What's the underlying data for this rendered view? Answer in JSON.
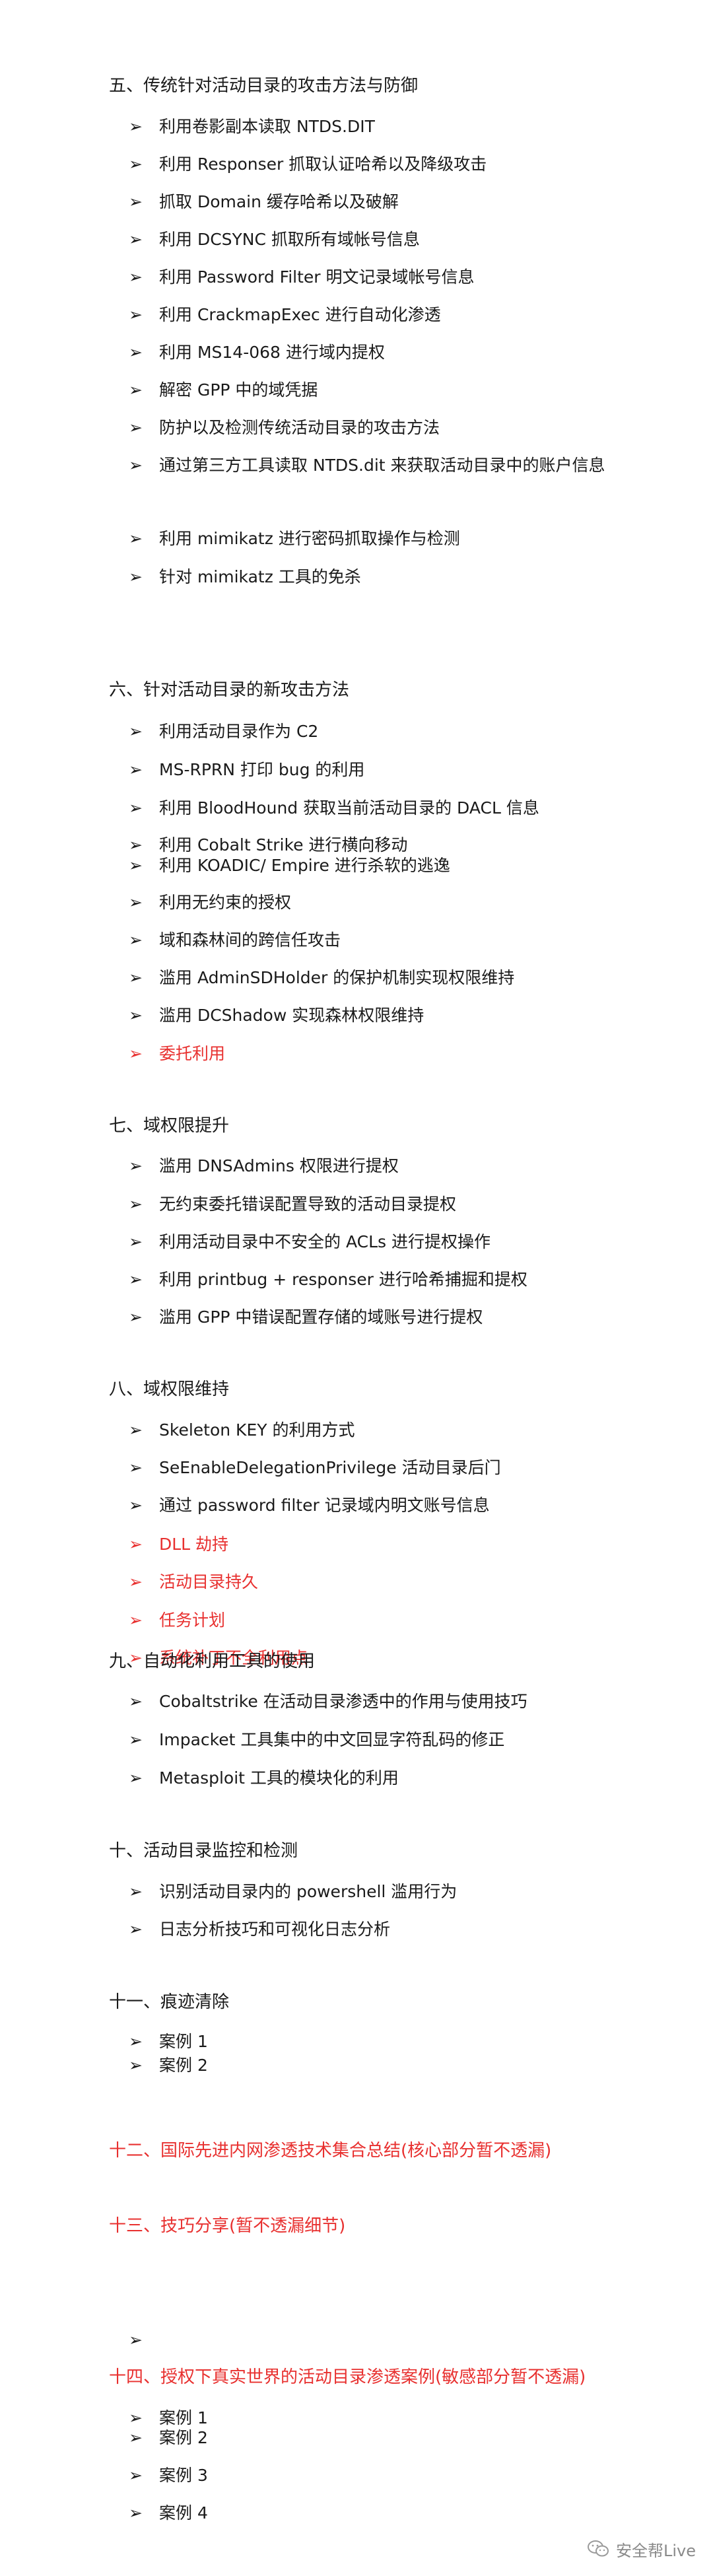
{
  "sections": [
    {
      "title": "五、传统针对活动目录的攻击方法与防御",
      "color": "#1a1a1a",
      "items": [
        {
          "text": "利用卷影副本读取 NTDS.DIT",
          "color": "#1a1a1a"
        },
        {
          "text": "利用 Responser 抓取认证哈希以及降级攻击",
          "color": "#1a1a1a"
        },
        {
          "text": "抓取 Domain 缓存哈希以及破解",
          "color": "#1a1a1a"
        },
        {
          "text": "利用 DCSYNC 抓取所有域帐号信息",
          "color": "#1a1a1a"
        },
        {
          "text": "利用 Password Filter 明文记录域帐号信息",
          "color": "#1a1a1a"
        },
        {
          "text": "利用 CrackmapExec 进行自动化渗透",
          "color": "#1a1a1a"
        },
        {
          "text": "利用 MS14-068 进行域内提权",
          "color": "#1a1a1a"
        },
        {
          "text": "解密 GPP 中的域凭据",
          "color": "#1a1a1a"
        },
        {
          "text": "防护以及检测传统活动目录的攻击方法",
          "color": "#1a1a1a"
        },
        {
          "text": "通过第三方工具读取 NTDS.dit 来获取活动目录中的账户信息",
          "color": "#1a1a1a"
        },
        {
          "text": "利用 mimikatz 进行密码抓取操作与检测",
          "color": "#1a1a1a"
        },
        {
          "text": "针对 mimikatz 工具的免杀",
          "color": "#1a1a1a"
        }
      ]
    },
    {
      "title": "六、针对活动目录的新攻击方法",
      "color": "#1a1a1a",
      "items": [
        {
          "text": "利用活动目录作为 C2",
          "color": "#1a1a1a"
        },
        {
          "text": "MS-RPRN 打印 bug 的利用",
          "color": "#1a1a1a"
        },
        {
          "text": "利用 BloodHound 获取当前活动目录的 DACL 信息",
          "color": "#1a1a1a"
        },
        {
          "text": "利用 Cobalt Strike 进行横向移动",
          "color": "#1a1a1a"
        },
        {
          "text": "利用 KOADIC/ Empire 进行杀软的逃逸",
          "color": "#1a1a1a"
        },
        {
          "text": "利用无约束的授权",
          "color": "#1a1a1a"
        },
        {
          "text": "域和森林间的跨信任攻击",
          "color": "#1a1a1a"
        },
        {
          "text": "滥用 AdminSDHolder 的保护机制实现权限维持",
          "color": "#1a1a1a"
        },
        {
          "text": "滥用 DCShadow 实现森林权限维持",
          "color": "#1a1a1a"
        },
        {
          "text": "委托利用",
          "color": "#e8302f"
        }
      ]
    },
    {
      "title": "七、域权限提升",
      "color": "#1a1a1a",
      "items": [
        {
          "text": "滥用 DNSAdmins 权限进行提权",
          "color": "#1a1a1a"
        },
        {
          "text": "无约束委托错误配置导致的活动目录提权",
          "color": "#1a1a1a"
        },
        {
          "text": "利用活动目录中不安全的 ACLs 进行提权操作",
          "color": "#1a1a1a"
        },
        {
          "text": "利用 printbug + responser 进行哈希捕掘和提权",
          "color": "#1a1a1a"
        },
        {
          "text": "滥用 GPP 中错误配置存储的域账号进行提权",
          "color": "#1a1a1a"
        }
      ]
    },
    {
      "title": "八、域权限维持",
      "color": "#1a1a1a",
      "items": [
        {
          "text": "Skeleton KEY 的利用方式",
          "color": "#1a1a1a"
        },
        {
          "text": "SeEnableDelegationPrivilege 活动目录后门",
          "color": "#1a1a1a"
        },
        {
          "text": "通过 password filter 记录域内明文账号信息",
          "color": "#1a1a1a"
        },
        {
          "text": "DLL 劫持",
          "color": "#e8302f"
        },
        {
          "text": "活动目录持久",
          "color": "#e8302f"
        },
        {
          "text": "任务计划",
          "color": "#e8302f"
        },
        {
          "text": "系统补丁不全利用点",
          "color": "#e8302f"
        }
      ]
    },
    {
      "title": "九、自动化利用工具的使用",
      "color": "#1a1a1a",
      "items": [
        {
          "text": "Cobaltstrike 在活动目录渗透中的作用与使用技巧",
          "color": "#1a1a1a"
        },
        {
          "text": "Impacket 工具集中的中文回显字符乱码的修正",
          "color": "#1a1a1a"
        },
        {
          "text": "Metasploit 工具的模块化的利用",
          "color": "#1a1a1a"
        }
      ]
    },
    {
      "title": "十、活动目录监控和检测",
      "color": "#1a1a1a",
      "items": [
        {
          "text": "识别活动目录内的 powershell 滥用行为",
          "color": "#1a1a1a"
        },
        {
          "text": "日志分析技巧和可视化日志分析",
          "color": "#1a1a1a"
        }
      ]
    },
    {
      "title": "十一、痕迹清除",
      "color": "#1a1a1a",
      "items": [
        {
          "text": "案例 1",
          "color": "#1a1a1a"
        },
        {
          "text": "案例 2",
          "color": "#1a1a1a"
        }
      ]
    },
    {
      "title": "十二、国际先进内网渗透技术集合总结(核心部分暂不透漏)",
      "color": "#e8302f",
      "items": []
    },
    {
      "title": "十三、技巧分享(暂不透漏细节)",
      "color": "#e8302f",
      "items": [
        {
          "text": "",
          "color": "#1a1a1a"
        }
      ]
    },
    {
      "title": "十四、授权下真实世界的活动目录渗透案例(敏感部分暂不透漏)",
      "color": "#e8302f",
      "items": [
        {
          "text": "案例 1",
          "color": "#1a1a1a"
        },
        {
          "text": "案例 2",
          "color": "#1a1a1a"
        },
        {
          "text": "案例 3",
          "color": "#1a1a1a"
        },
        {
          "text": "案例 4",
          "color": "#1a1a1a"
        }
      ]
    }
  ],
  "bullet_glyph": "➢",
  "watermark": {
    "text": "安全帮Live",
    "icon": "wechat-icon"
  }
}
